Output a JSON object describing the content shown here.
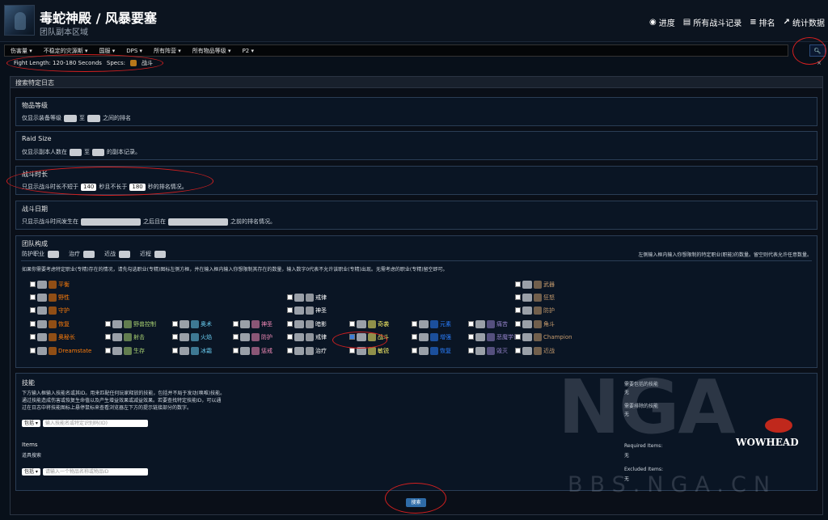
{
  "header": {
    "title": "毒蛇神殿 / 风暴要塞",
    "subtitle": "团队副本区域",
    "nav": [
      {
        "icon": "globe-icon",
        "label": "进度"
      },
      {
        "icon": "list-icon",
        "label": "所有战斗记录"
      },
      {
        "icon": "bars-icon",
        "label": "排名"
      },
      {
        "icon": "chart-icon",
        "label": "统计数据"
      }
    ]
  },
  "filters": [
    "伤害量",
    "不稳定的灾源斯",
    "国服",
    "DPS",
    "所有阵营",
    "所有物品等级",
    "P2"
  ],
  "crumb": {
    "fight_length": "Fight Length: 120-180 Seconds",
    "specs_label": "Specs:",
    "spec": "战斗",
    "close": "×"
  },
  "box_title": "搜索特定日志",
  "item_level": {
    "title": "物品等级",
    "pre": "仅显示装备等级",
    "mid": "至",
    "post": "之间的排名"
  },
  "raid_size": {
    "title": "Raid Size",
    "pre": "仅显示副本人数在",
    "mid": "至",
    "post": "的副本记录。"
  },
  "fight_dur": {
    "title": "战斗时长",
    "pre": "只显示战斗时长不短于",
    "min": "140",
    "mid": "秒且不长于",
    "max": "180",
    "post": "秒的排名情况。"
  },
  "fight_date": {
    "title": "战斗日期",
    "pre": "只显示战斗时间发生在",
    "mid": "之后且在",
    "post": "之前的排名情况。"
  },
  "comp": {
    "title": "团队构成",
    "roles": [
      "防护职业",
      "治疗",
      "近战",
      "近程"
    ],
    "right_note": "左侧输入框内输入你想限制的特定职业(职能)的数量。留空则代表允许任意数量。",
    "help": "如果你需要考虑特定职业(专精)存在的情况，请先勾选职业(专精)图标左侧方框，并在输入框内输入你想限制其存在的数量，输入数字0代表不允许该职业(专精)出现。无需考虑的职业(专精)留空即可。"
  },
  "specs": {
    "druid": [
      {
        "n": "平衡",
        "c": "#ff7d0a"
      },
      {
        "n": "野性",
        "c": "#ff7d0a"
      },
      {
        "n": "守护",
        "c": "#ff7d0a"
      },
      {
        "n": "恢复",
        "c": "#ff7d0a"
      },
      {
        "n": "奥秘长",
        "c": "#ff7d0a"
      },
      {
        "n": "Dreamstate",
        "c": "#ff7d0a"
      }
    ],
    "hunter": [
      {
        "n": "野兽控制",
        "c": "#abd473"
      },
      {
        "n": "射击",
        "c": "#abd473"
      },
      {
        "n": "生存",
        "c": "#abd473"
      }
    ],
    "mage": [
      {
        "n": "奥术",
        "c": "#69ccf0"
      },
      {
        "n": "火焰",
        "c": "#69ccf0"
      },
      {
        "n": "冰霜",
        "c": "#69ccf0"
      }
    ],
    "paladin": [
      {
        "n": "神圣",
        "c": "#f58cba"
      },
      {
        "n": "防护",
        "c": "#f58cba"
      },
      {
        "n": "惩戒",
        "c": "#f58cba"
      }
    ],
    "priest": [
      {
        "n": "戒律",
        "c": "#ffffff"
      },
      {
        "n": "神圣",
        "c": "#ffffff"
      },
      {
        "n": "暗影",
        "c": "#ffffff"
      },
      {
        "n": "戒律",
        "c": "#ffffff"
      },
      {
        "n": "治疗",
        "c": "#ffffff"
      }
    ],
    "rogue": [
      {
        "n": "奇袭",
        "c": "#fff569"
      },
      {
        "n": "战斗",
        "c": "#fff569"
      },
      {
        "n": "敏锐",
        "c": "#fff569"
      }
    ],
    "shaman": [
      {
        "n": "元素",
        "c": "#2a7fff"
      },
      {
        "n": "增强",
        "c": "#2a7fff"
      },
      {
        "n": "恢复",
        "c": "#2a7fff"
      }
    ],
    "warlock": [
      {
        "n": "痛苦",
        "c": "#9482c9"
      },
      {
        "n": "恶魔学识",
        "c": "#9482c9"
      },
      {
        "n": "毁灭",
        "c": "#9482c9"
      }
    ],
    "warrior": [
      {
        "n": "武器",
        "c": "#c79c6e"
      },
      {
        "n": "狂怒",
        "c": "#c79c6e"
      },
      {
        "n": "防护",
        "c": "#c79c6e"
      },
      {
        "n": "角斗",
        "c": "#c79c6e"
      },
      {
        "n": "Champion",
        "c": "#c79c6e"
      },
      {
        "n": "近战",
        "c": "#c79c6e"
      }
    ]
  },
  "abilities": {
    "title": "技能",
    "desc": [
      "下方输入框输入技能名或其ID。用来匹配任何玩家释放的技能，包括并不局于发动(唤唯)技能。",
      "通过技能造成伤害或恢复生命值以及产生增益效果或减益效果。若要查找特定技能ID，可以通",
      "过在日志中将技能图标上悬停鼠标来查看浏览器左下方的提示链接部分的数字。"
    ],
    "include": "包括",
    "placeholder": "输入技能名或特定识别码(ID)",
    "need_label": "需要包括的技能",
    "need_val": "无",
    "excl_label": "需要排除的技能",
    "excl_val": "无"
  },
  "items": {
    "title": "Items",
    "sub": "道具搜索",
    "include": "包括",
    "placeholder": "请输入一个物品名称或物品ID",
    "req_label": "Required Items:",
    "req_val": "无",
    "excl_label": "Excluded Items:",
    "excl_val": "无"
  },
  "search_button": "搜索",
  "watermark": {
    "logo": "NGA",
    "url": "BBS.NGA.CN",
    "brand": "WOWHEAD"
  }
}
